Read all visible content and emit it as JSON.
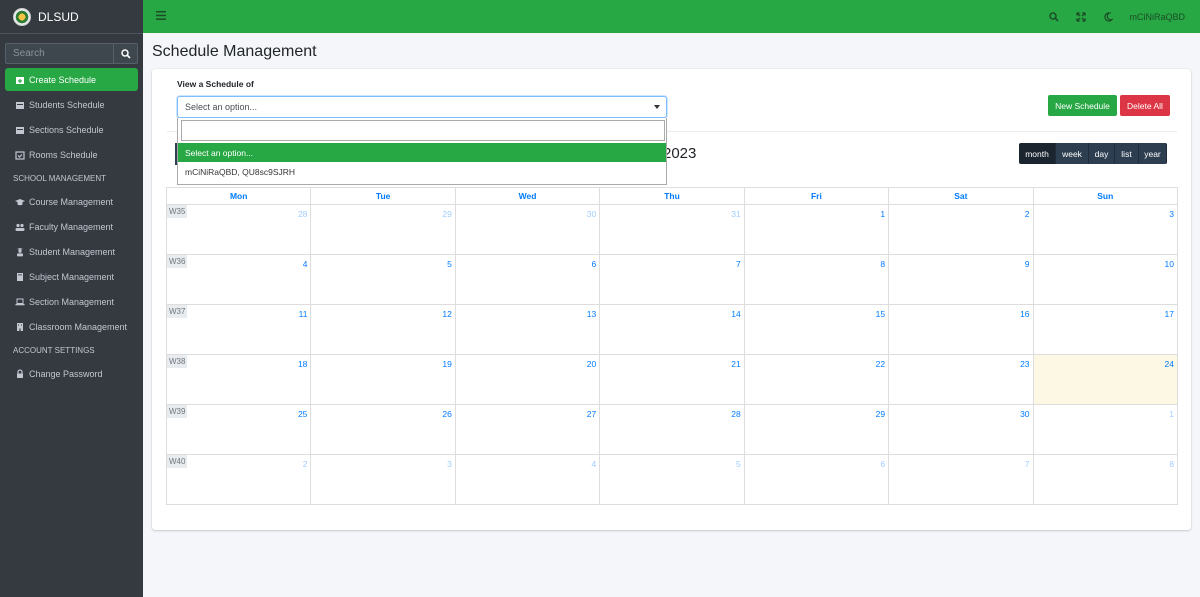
{
  "sidebar": {
    "brand": "DLSUD",
    "search_placeholder": "Search",
    "items_top": [
      {
        "label": "Create Schedule",
        "icon": "calendar-plus-icon",
        "active": true
      },
      {
        "label": "Students Schedule",
        "icon": "calendar-icon"
      },
      {
        "label": "Sections Schedule",
        "icon": "calendar-icon"
      },
      {
        "label": "Rooms Schedule",
        "icon": "calendar-check-icon"
      }
    ],
    "header_school": "SCHOOL MANAGEMENT",
    "items_school": [
      {
        "label": "Course Management",
        "icon": "graduation-cap-icon"
      },
      {
        "label": "Faculty Management",
        "icon": "users-icon"
      },
      {
        "label": "Student Management",
        "icon": "user-graduate-icon"
      },
      {
        "label": "Subject Management",
        "icon": "book-icon"
      },
      {
        "label": "Section Management",
        "icon": "laptop-icon"
      },
      {
        "label": "Classroom Management",
        "icon": "building-icon"
      }
    ],
    "header_account": "ACCOUNT SETTINGS",
    "items_account": [
      {
        "label": "Change Password",
        "icon": "lock-icon"
      }
    ]
  },
  "topbar": {
    "username": "mCiNiRaQBD"
  },
  "main": {
    "page_title": "Schedule Management",
    "view_label": "View a Schedule of",
    "select_placeholder": "Select an option...",
    "dropdown_options": [
      "Select an option...",
      "mCiNiRaQBD, QU8sc9SJRH"
    ],
    "new_schedule_label": "New Schedule",
    "delete_all_label": "Delete All",
    "calendar_title": "2023",
    "view_buttons": [
      "month",
      "week",
      "day",
      "list",
      "year"
    ],
    "active_view": "month",
    "weekdays": [
      "Mon",
      "Tue",
      "Wed",
      "Thu",
      "Fri",
      "Sat",
      "Sun"
    ],
    "weeks": [
      {
        "label": "W35",
        "days": [
          {
            "n": "28",
            "o": true
          },
          {
            "n": "29",
            "o": true
          },
          {
            "n": "30",
            "o": true
          },
          {
            "n": "31",
            "o": true
          },
          {
            "n": "1"
          },
          {
            "n": "2"
          },
          {
            "n": "3"
          }
        ]
      },
      {
        "label": "W36",
        "days": [
          {
            "n": "4"
          },
          {
            "n": "5"
          },
          {
            "n": "6"
          },
          {
            "n": "7"
          },
          {
            "n": "8"
          },
          {
            "n": "9"
          },
          {
            "n": "10"
          }
        ]
      },
      {
        "label": "W37",
        "days": [
          {
            "n": "11"
          },
          {
            "n": "12"
          },
          {
            "n": "13"
          },
          {
            "n": "14"
          },
          {
            "n": "15"
          },
          {
            "n": "16"
          },
          {
            "n": "17"
          }
        ]
      },
      {
        "label": "W38",
        "days": [
          {
            "n": "18"
          },
          {
            "n": "19"
          },
          {
            "n": "20"
          },
          {
            "n": "21"
          },
          {
            "n": "22"
          },
          {
            "n": "23"
          },
          {
            "n": "24",
            "today": true
          }
        ]
      },
      {
        "label": "W39",
        "days": [
          {
            "n": "25"
          },
          {
            "n": "26"
          },
          {
            "n": "27"
          },
          {
            "n": "28"
          },
          {
            "n": "29"
          },
          {
            "n": "30"
          },
          {
            "n": "1",
            "o": true
          }
        ]
      },
      {
        "label": "W40",
        "days": [
          {
            "n": "2",
            "o": true
          },
          {
            "n": "3",
            "o": true
          },
          {
            "n": "4",
            "o": true
          },
          {
            "n": "5",
            "o": true
          },
          {
            "n": "6",
            "o": true
          },
          {
            "n": "7",
            "o": true
          },
          {
            "n": "8",
            "o": true
          }
        ]
      }
    ]
  },
  "colors": {
    "accent": "#28a745",
    "danger": "#dc3545",
    "sidebar_bg": "#343a40",
    "link": "#007bff",
    "today_bg": "#fcf8e3"
  }
}
